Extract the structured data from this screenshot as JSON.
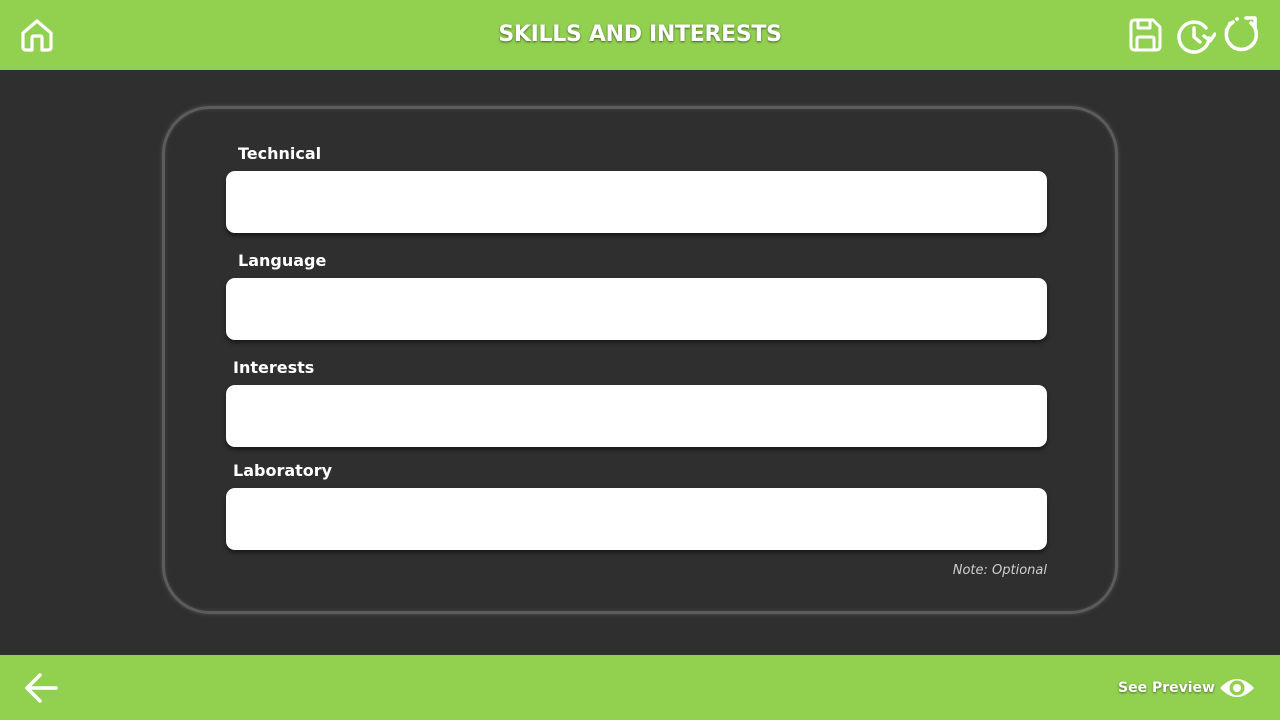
{
  "header": {
    "title": "SKILLS AND INTERESTS",
    "icons": [
      "home-icon",
      "save-icon",
      "history-icon",
      "reset-icon"
    ]
  },
  "form": {
    "fields": [
      {
        "label": "Technical",
        "value": ""
      },
      {
        "label": "Language",
        "value": ""
      },
      {
        "label": "Interests",
        "value": ""
      },
      {
        "label": "Laboratory",
        "value": ""
      }
    ],
    "note": "Note: Optional"
  },
  "footer": {
    "back_icon": "back-arrow-icon",
    "preview_label": "See Preview",
    "preview_icon": "eye-icon"
  },
  "colors": {
    "bar": "#92d050",
    "background": "#2f2f2f",
    "card_border": "#5c5c5c",
    "input": "#ffffff"
  }
}
